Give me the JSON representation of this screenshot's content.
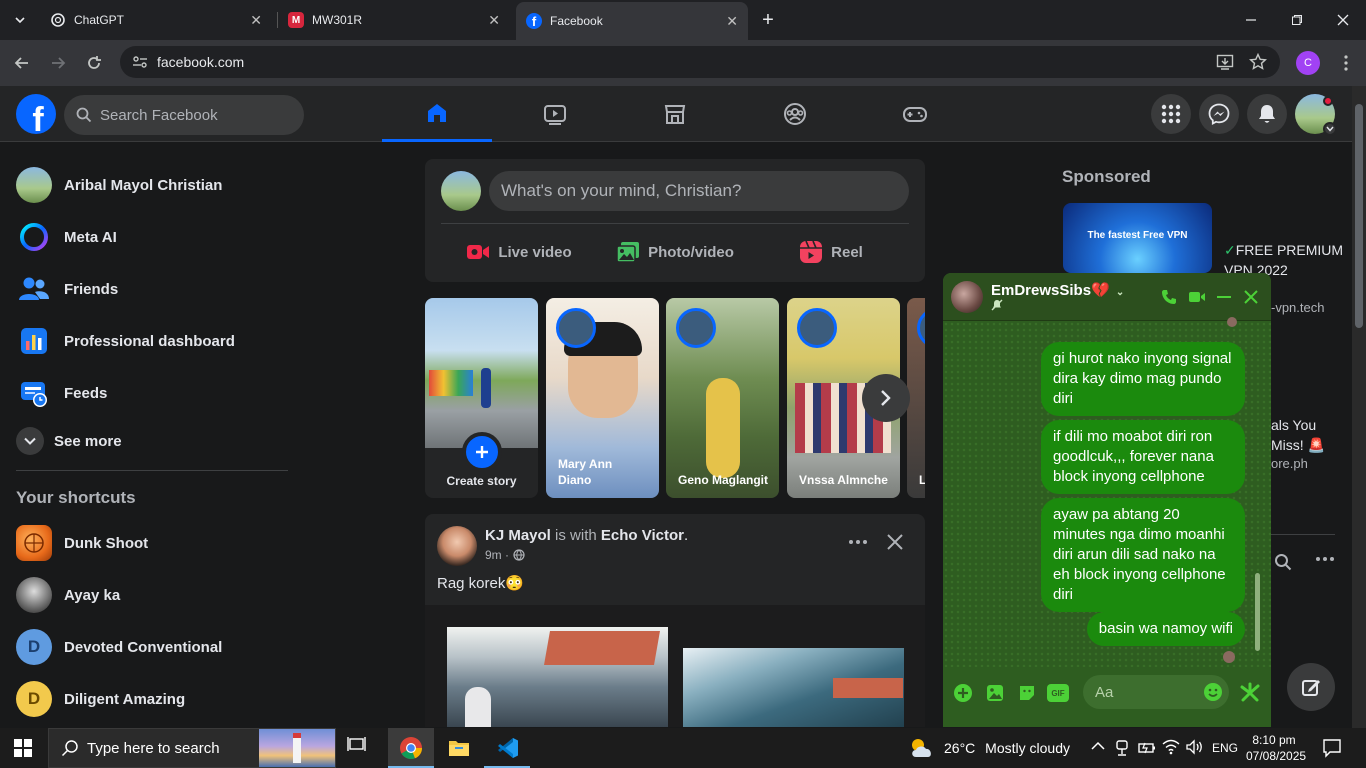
{
  "browser": {
    "tabs": [
      {
        "title": "ChatGPT",
        "icon": "chatgpt-icon"
      },
      {
        "title": "MW301R",
        "icon": "mercusys-icon"
      },
      {
        "title": "Facebook",
        "icon": "facebook-icon"
      }
    ],
    "new_tab": "+",
    "url": "facebook.com",
    "profile_initial": "C"
  },
  "facebook": {
    "search_placeholder": "Search Facebook",
    "left_nav": [
      {
        "label": "Aribal Mayol Christian",
        "icon": "profile-avatar"
      },
      {
        "label": "Meta AI",
        "icon": "meta-ai-icon"
      },
      {
        "label": "Friends",
        "icon": "friends-icon"
      },
      {
        "label": "Professional dashboard",
        "icon": "dashboard-icon"
      },
      {
        "label": "Feeds",
        "icon": "feeds-icon"
      },
      {
        "label": "See more",
        "icon": "chevron-down-icon"
      }
    ],
    "shortcuts_title": "Your shortcuts",
    "shortcuts": [
      {
        "label": "Dunk Shoot",
        "initial": ""
      },
      {
        "label": "Ayay ka",
        "initial": ""
      },
      {
        "label": "Devoted Conventional",
        "initial": "D"
      },
      {
        "label": "Diligent Amazing",
        "initial": "D"
      }
    ],
    "composer": {
      "placeholder": "What's on your mind, Christian?",
      "actions": [
        "Live video",
        "Photo/video",
        "Reel"
      ]
    },
    "stories": {
      "create_label": "Create story",
      "items": [
        {
          "name": "Mary Ann Diano"
        },
        {
          "name": "Geno Maglangit"
        },
        {
          "name": "Vnssa Almnche"
        },
        {
          "name": "L P"
        }
      ]
    },
    "post": {
      "author": "KJ Mayol",
      "with_text": "is with",
      "tagged": "Echo Victor",
      "period": ".",
      "time": "9m ·",
      "text": "Rag korek😳"
    },
    "sponsored": {
      "title": "Sponsored",
      "ad1_image_text": "The fastest Free VPN",
      "ad1_title": "FREE PREMIUM VPN 2022",
      "ad1_domain": "-vpn.tech",
      "ad2_title": "als You Miss!",
      "ad2_domain": "ore.ph"
    }
  },
  "chat": {
    "name": "EmDrewsSibs💔",
    "messages": [
      "gi hurot nako inyong signal dira kay dimo mag pundo diri",
      "if dili mo moabot diri ron goodlcuk,,, forever nana block inyong cellphone",
      "ayaw pa abtang 20 minutes nga dimo moanhi diri arun dili sad nako na eh block inyong cellphone diri",
      "basin wa namoy wifi"
    ],
    "input_placeholder": "Aa"
  },
  "taskbar": {
    "search_placeholder": "Type here to search",
    "weather_temp": "26°C",
    "weather_text": "Mostly cloudy",
    "language": "ENG",
    "time": "8:10 pm",
    "date": "07/08/2025"
  },
  "colors": {
    "fb_blue": "#0866ff",
    "chat_bg": "#2e5d20",
    "bubble": "#1b8a0d"
  }
}
